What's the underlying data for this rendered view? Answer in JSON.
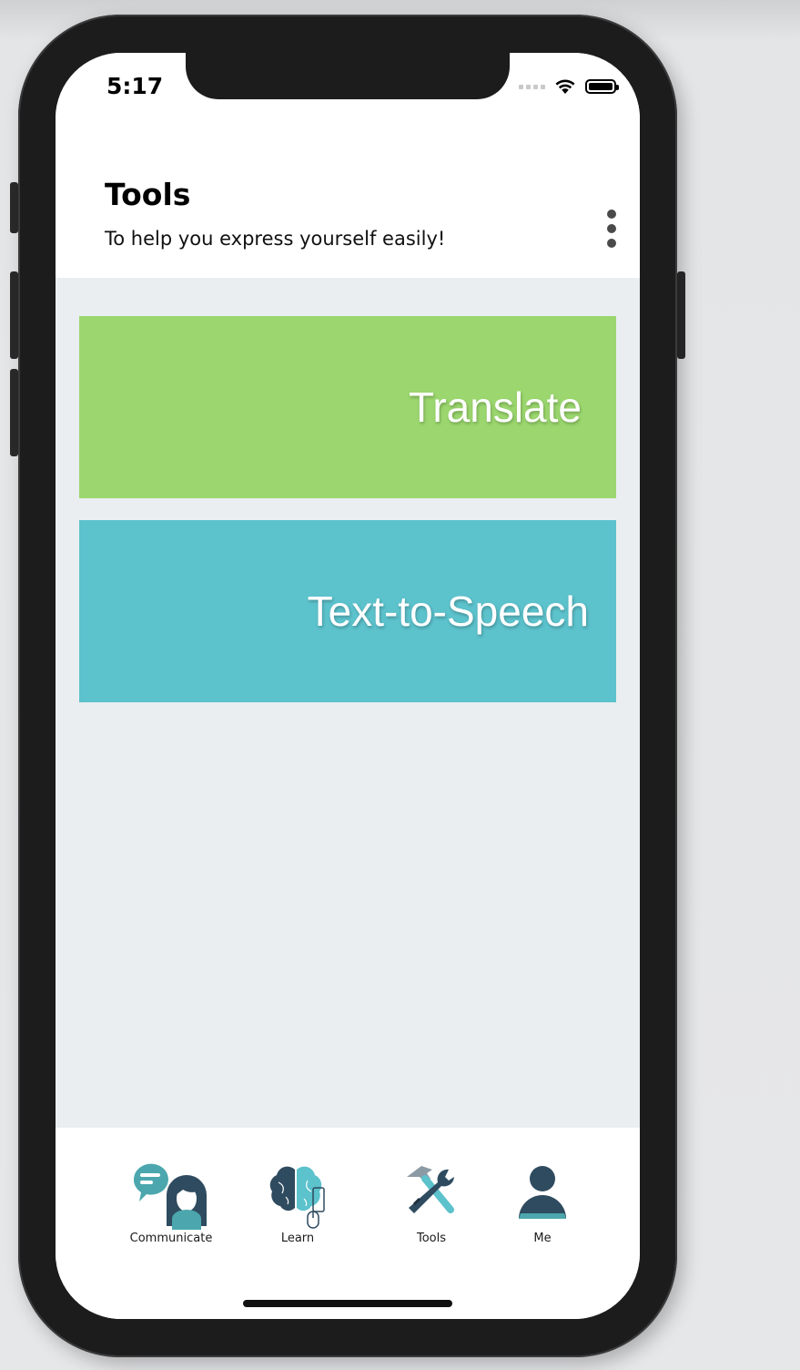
{
  "status_bar": {
    "time": "5:17",
    "icons": [
      "signal-icon",
      "wifi-icon",
      "battery-icon"
    ]
  },
  "header": {
    "title": "Tools",
    "subtitle": "To help you express yourself easily!",
    "menu_icon": "more-vertical-icon"
  },
  "tools": [
    {
      "label": "Translate",
      "color": "#9bd76e"
    },
    {
      "label": "Text-to-Speech",
      "color": "#5cc2cc"
    }
  ],
  "tabbar": {
    "tabs": [
      {
        "label": "Communicate",
        "icon": "communicate-icon"
      },
      {
        "label": "Learn",
        "icon": "brain-icon"
      },
      {
        "label": "Tools",
        "icon": "tools-icon"
      },
      {
        "label": "Me",
        "icon": "person-icon"
      }
    ]
  },
  "colors": {
    "content_background": "#eaeef0",
    "icon_dark": "#2f4b5f",
    "icon_teal": "#4ba7ad"
  }
}
